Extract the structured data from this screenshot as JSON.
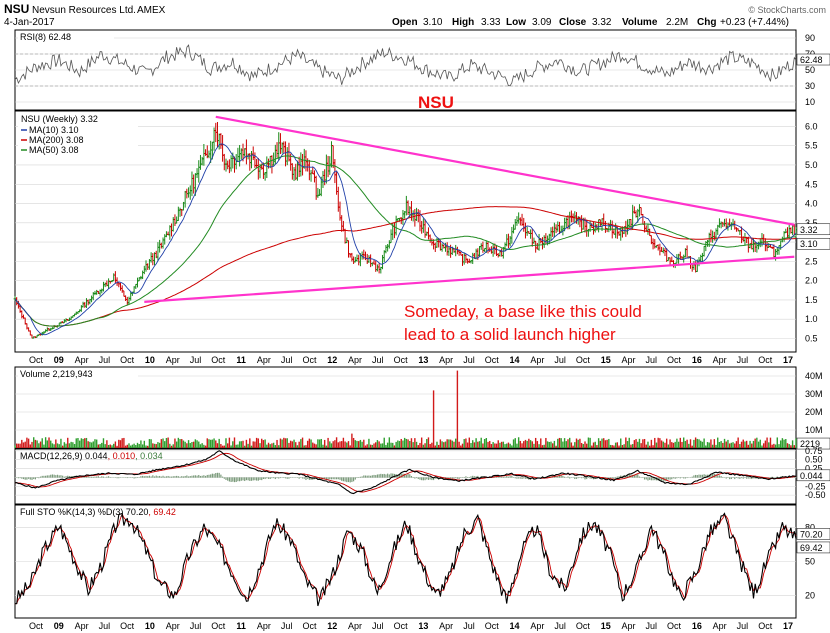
{
  "header": {
    "symbol": "NSU",
    "company": "Nevsun Resources Ltd.",
    "exchange": "AMEX",
    "date": "4-Jan-2017",
    "open_label": "Open",
    "open": "3.10",
    "high_label": "High",
    "high": "3.33",
    "low_label": "Low",
    "low": "3.09",
    "close_label": "Close",
    "close": "3.32",
    "volume_label": "Volume",
    "volume": "2.2M",
    "chg_label": "Chg",
    "chg": "+0.23 (+7.44%)",
    "credit": "© StockCharts.com"
  },
  "colors": {
    "price_up": "#1a8a1a",
    "price_down": "#cc0000",
    "ma10": "#1f3fa8",
    "ma200": "#cc0000",
    "ma50": "#228b22",
    "trendline": "#ff33cc",
    "annotation": "#ee1111",
    "panel_bg": "#ffffff",
    "grid": "#d6d6d6",
    "histogram": "#7a9a7a"
  },
  "chart_data": [
    {
      "type": "line",
      "panel": "rsi",
      "legend": "RSI(8) 62.48",
      "ylim": [
        0,
        100
      ],
      "yticks": [
        "90",
        "70",
        "50",
        "30",
        "10"
      ],
      "last_label": "62.48",
      "values": [
        38,
        55,
        62,
        48,
        70,
        58,
        45,
        66,
        74,
        52,
        60,
        42,
        55,
        68,
        50,
        38,
        58,
        72,
        64,
        50,
        40,
        56,
        46,
        35,
        52,
        62,
        48,
        58,
        70,
        55,
        44,
        60,
        52,
        66,
        58,
        42,
        62.48
      ]
    },
    {
      "type": "line",
      "panel": "price",
      "title": "NSU",
      "legend": "NSU (Weekly) 3.32",
      "ylim": [
        0.15,
        6.4
      ],
      "yticks": [
        "6.0",
        "5.5",
        "5.0",
        "4.5",
        "4.0",
        "3.5",
        "3.0",
        "2.5",
        "2.0",
        "1.5",
        "1.0",
        "0.5"
      ],
      "last_labels": [
        "3.32",
        "3.10"
      ],
      "x": [
        "Oct",
        "09",
        "Apr",
        "Jul",
        "Oct",
        "10",
        "Apr",
        "Jul",
        "Oct",
        "11",
        "Apr",
        "Jul",
        "Oct",
        "12",
        "Apr",
        "Jul",
        "Oct",
        "13",
        "Apr",
        "Jul",
        "Oct",
        "14",
        "Apr",
        "Jul",
        "Oct",
        "15",
        "Apr",
        "Jul",
        "Oct",
        "16",
        "Apr",
        "Jul",
        "Oct",
        "17"
      ],
      "anchors": [
        [
          0,
          1.5
        ],
        [
          4,
          1.1
        ],
        [
          10,
          0.5
        ],
        [
          20,
          0.75
        ],
        [
          32,
          1.0
        ],
        [
          40,
          1.35
        ],
        [
          48,
          1.7
        ],
        [
          58,
          2.1
        ],
        [
          66,
          1.45
        ],
        [
          76,
          2.3
        ],
        [
          86,
          2.9
        ],
        [
          94,
          3.6
        ],
        [
          104,
          4.5
        ],
        [
          112,
          5.2
        ],
        [
          118,
          6.0
        ],
        [
          124,
          5.0
        ],
        [
          134,
          5.4
        ],
        [
          146,
          4.9
        ],
        [
          156,
          5.5
        ],
        [
          164,
          4.8
        ],
        [
          172,
          5.1
        ],
        [
          178,
          4.2
        ],
        [
          186,
          5.3
        ],
        [
          192,
          3.4
        ],
        [
          198,
          2.5
        ],
        [
          206,
          2.6
        ],
        [
          214,
          2.3
        ],
        [
          222,
          3.3
        ],
        [
          230,
          3.9
        ],
        [
          238,
          3.5
        ],
        [
          246,
          3.0
        ],
        [
          256,
          2.8
        ],
        [
          266,
          2.5
        ],
        [
          276,
          2.9
        ],
        [
          286,
          2.7
        ],
        [
          296,
          3.6
        ],
        [
          306,
          2.9
        ],
        [
          316,
          3.2
        ],
        [
          326,
          3.6
        ],
        [
          336,
          3.4
        ],
        [
          346,
          3.5
        ],
        [
          356,
          3.2
        ],
        [
          366,
          3.85
        ],
        [
          376,
          2.9
        ],
        [
          386,
          2.5
        ],
        [
          394,
          2.7
        ],
        [
          400,
          2.3
        ],
        [
          408,
          3.1
        ],
        [
          416,
          3.5
        ],
        [
          424,
          3.3
        ],
        [
          432,
          2.9
        ],
        [
          440,
          3.0
        ],
        [
          446,
          2.7
        ],
        [
          452,
          3.15
        ],
        [
          458,
          3.32
        ]
      ],
      "series": [
        {
          "name": "MA(10) 3.10",
          "indicator": "ma10",
          "last": 3.1
        },
        {
          "name": "MA(200) 3.08",
          "indicator": "ma200",
          "last": 3.08
        },
        {
          "name": "MA(50) 3.08",
          "indicator": "ma50",
          "last": 3.08
        }
      ],
      "trendlines": [
        {
          "from": [
            118,
            6.25
          ],
          "to": [
            458,
            3.45
          ]
        },
        {
          "from": [
            76,
            1.45
          ],
          "to": [
            458,
            2.62
          ]
        }
      ],
      "annotation": [
        "Someday, a base like this could",
        "lead to a solid launch higher"
      ]
    },
    {
      "type": "bar",
      "panel": "volume",
      "legend": "Volume 2,219,943",
      "ylim": [
        0,
        45
      ],
      "yticks": [
        "40M",
        "30M",
        "20M",
        "10M"
      ],
      "last_label": "2219",
      "unit": "M",
      "spikes": [
        [
          246,
          32
        ],
        [
          260,
          43
        ],
        [
          246,
          12
        ],
        [
          198,
          8
        ]
      ]
    },
    {
      "type": "line",
      "panel": "macd",
      "legend_prefix": "MACD(12,26,9)",
      "macd": "0.044",
      "signal": "0.010",
      "histogram": "0.034",
      "ylim": [
        -0.75,
        0.8
      ],
      "yticks": [
        "0.75",
        "0.50",
        "0.25",
        "0.00",
        "-0.25",
        "-0.50"
      ],
      "last_label": "0.044",
      "anchors": [
        [
          0,
          -0.15
        ],
        [
          12,
          -0.3
        ],
        [
          24,
          -0.1
        ],
        [
          40,
          0.05
        ],
        [
          56,
          0.12
        ],
        [
          70,
          0.08
        ],
        [
          84,
          0.22
        ],
        [
          100,
          0.35
        ],
        [
          112,
          0.5
        ],
        [
          120,
          0.74
        ],
        [
          130,
          0.45
        ],
        [
          142,
          0.2
        ],
        [
          154,
          0.12
        ],
        [
          166,
          0.1
        ],
        [
          178,
          -0.05
        ],
        [
          190,
          -0.2
        ],
        [
          198,
          -0.45
        ],
        [
          210,
          -0.3
        ],
        [
          224,
          0.05
        ],
        [
          232,
          0.22
        ],
        [
          244,
          0.02
        ],
        [
          260,
          -0.1
        ],
        [
          276,
          0.0
        ],
        [
          292,
          0.1
        ],
        [
          306,
          -0.05
        ],
        [
          322,
          0.12
        ],
        [
          338,
          0.02
        ],
        [
          352,
          -0.08
        ],
        [
          366,
          0.18
        ],
        [
          382,
          -0.15
        ],
        [
          396,
          -0.2
        ],
        [
          412,
          0.15
        ],
        [
          428,
          0.05
        ],
        [
          442,
          -0.05
        ],
        [
          458,
          0.044
        ]
      ]
    },
    {
      "type": "line",
      "panel": "stochastic",
      "legend_prefix": "Full STO %K(14,3) %D(3)",
      "k": "70.20",
      "d": "69.42",
      "ylim": [
        0,
        100
      ],
      "yticks": [
        "80",
        "50",
        "20"
      ],
      "last_labels": [
        "70.20",
        "69.42"
      ],
      "values": [
        15,
        30,
        60,
        82,
        55,
        25,
        48,
        85,
        88,
        60,
        30,
        20,
        55,
        80,
        65,
        40,
        18,
        50,
        85,
        70,
        35,
        15,
        40,
        78,
        60,
        22,
        55,
        85,
        50,
        20,
        35,
        75,
        88,
        45,
        15,
        60,
        80,
        40,
        25,
        70,
        85,
        60,
        20,
        45,
        82,
        50,
        18,
        40,
        75,
        88,
        55,
        22,
        50,
        80,
        70.2
      ]
    }
  ]
}
